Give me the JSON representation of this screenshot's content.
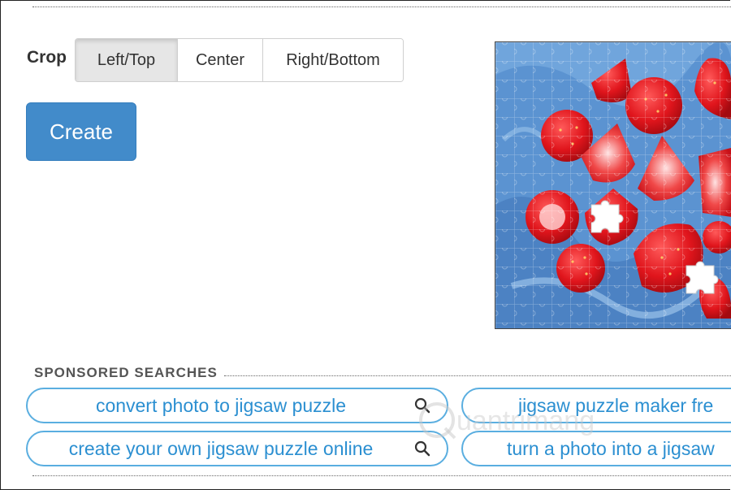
{
  "crop": {
    "label": "Crop",
    "options": [
      "Left/Top",
      "Center",
      "Right/Bottom"
    ],
    "selected": "Left/Top"
  },
  "create_label": "Create",
  "sponsored": {
    "title": "SPONSORED SEARCHES",
    "items": [
      "convert photo to jigsaw puzzle",
      "jigsaw puzzle maker fre",
      "create your own jigsaw puzzle online",
      "turn a photo into a jigsaw"
    ]
  },
  "watermark": "Quantrimang",
  "colors": {
    "accent": "#428bca",
    "link": "#2b8fd1",
    "pill_border": "#5aaee0"
  }
}
